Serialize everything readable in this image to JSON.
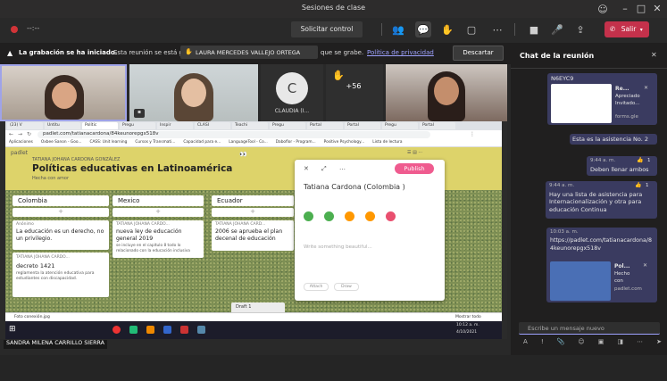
{
  "window": {
    "title": "Sesiones de clase"
  },
  "meeting_bar": {
    "timer": "--:--",
    "request_control": "Solicitar control",
    "leave": "Salir"
  },
  "banner": {
    "strong": "La grabación se ha iniciado.",
    "text": "Esta reunión se está g",
    "text2": "que se grabe.",
    "privacy_link": "Política de privacidad",
    "dismiss": "Descartar",
    "raised_hand_name": "LAURA MERCEDES VALLEJO ORTEGA"
  },
  "videos": {
    "avatar_initial": "C",
    "avatar_name": "CLAUDIA (I...",
    "more_count": "+56"
  },
  "browser": {
    "tabs": [
      "(23) V",
      "Untitu",
      "Polític",
      "Pregu",
      "Inspir",
      "CLASI",
      "Teachi",
      "Pregu",
      "Portal",
      "Portal",
      "Pregu",
      "Portal"
    ],
    "url": "padlet.com/tatianacardona/84keunorepgx518v",
    "bookmarks": [
      "Aplicaciones",
      "Oxbee Sanon - Goo...",
      "CASS: Unit learning",
      "Cursos y Transmati...",
      "Capacidad para e...",
      "LanguageTool - Co...",
      "Daboflor - Program...",
      "Positive Psychology...",
      "Lista de lectura"
    ]
  },
  "padlet": {
    "brand": "padlet",
    "author": "TATIANA JOHANA CARDONA GONZÁLEZ",
    "title": "Políticas educativas en Latinoamérica",
    "subtitle": "Hecha con amor",
    "columns": [
      "Colombia",
      "Mexico",
      "Ecuador"
    ],
    "posts": {
      "colombia_1_author": "Anónimo",
      "colombia_1_title": "La educación es un derecho, no un privilegio.",
      "colombia_2_author": "TATIANA JOHANA CARDO...",
      "colombia_2_title": "decreto 1421",
      "colombia_2_body": "reglamenta la atención educativa para estudiantes con discapacidad.",
      "mexico_1_author": "TATIANA JOHANA CARDO...",
      "mexico_1_title": "nueva ley de educación general 2019",
      "mexico_1_body": "se incluye en el capítulo 8 todo lo relacionado con la educación inclusiva",
      "ecuador_1_author": "TATIANA JOHANA CARD...",
      "ecuador_1_title": "2006 se aprueba el plan decenal de educación"
    },
    "editor": {
      "publish": "Publish",
      "title_value": "Tatiana Cardona (Colombia )",
      "body_placeholder": "Write something beautiful...",
      "chip1": "Attach",
      "chip2": "Draw"
    },
    "draft_label": "Draft 1",
    "download_file": "Foto conexión.jpg",
    "show_all": "Mostrar todo"
  },
  "taskbar": {
    "time": "10:12 a. m.",
    "date": "4/10/2021"
  },
  "presenter_name": "SANDRA MILENA CARRILLO SIERRA",
  "chat": {
    "title": "Chat de la reunión",
    "code": "N6EYC9",
    "doc_title": "Re...",
    "doc_sub": "Apreciado",
    "doc_sub2": "Invitado...",
    "doc_link": "forms.gle",
    "msg1": "Esta es la asistencia No. 2",
    "msg2_time": "9:44 a. m.",
    "msg2_count": "1",
    "msg2": "Deben llenar ambos",
    "msg3_time": "9:44 a. m.",
    "msg3_count": "1",
    "msg3": "Hay una lista de asistencia para Internacionalización y otra para educación Continua",
    "msg4_time": "10:03 a. m.",
    "msg4_link": "https://padlet.com/tatianacardona/84keunorepgx518v",
    "card_title": "Pol...",
    "card_sub": "Hecho",
    "card_sub2": "con",
    "card_domain": "padlet.com",
    "compose_placeholder": "Escribe un mensaje nuevo"
  }
}
